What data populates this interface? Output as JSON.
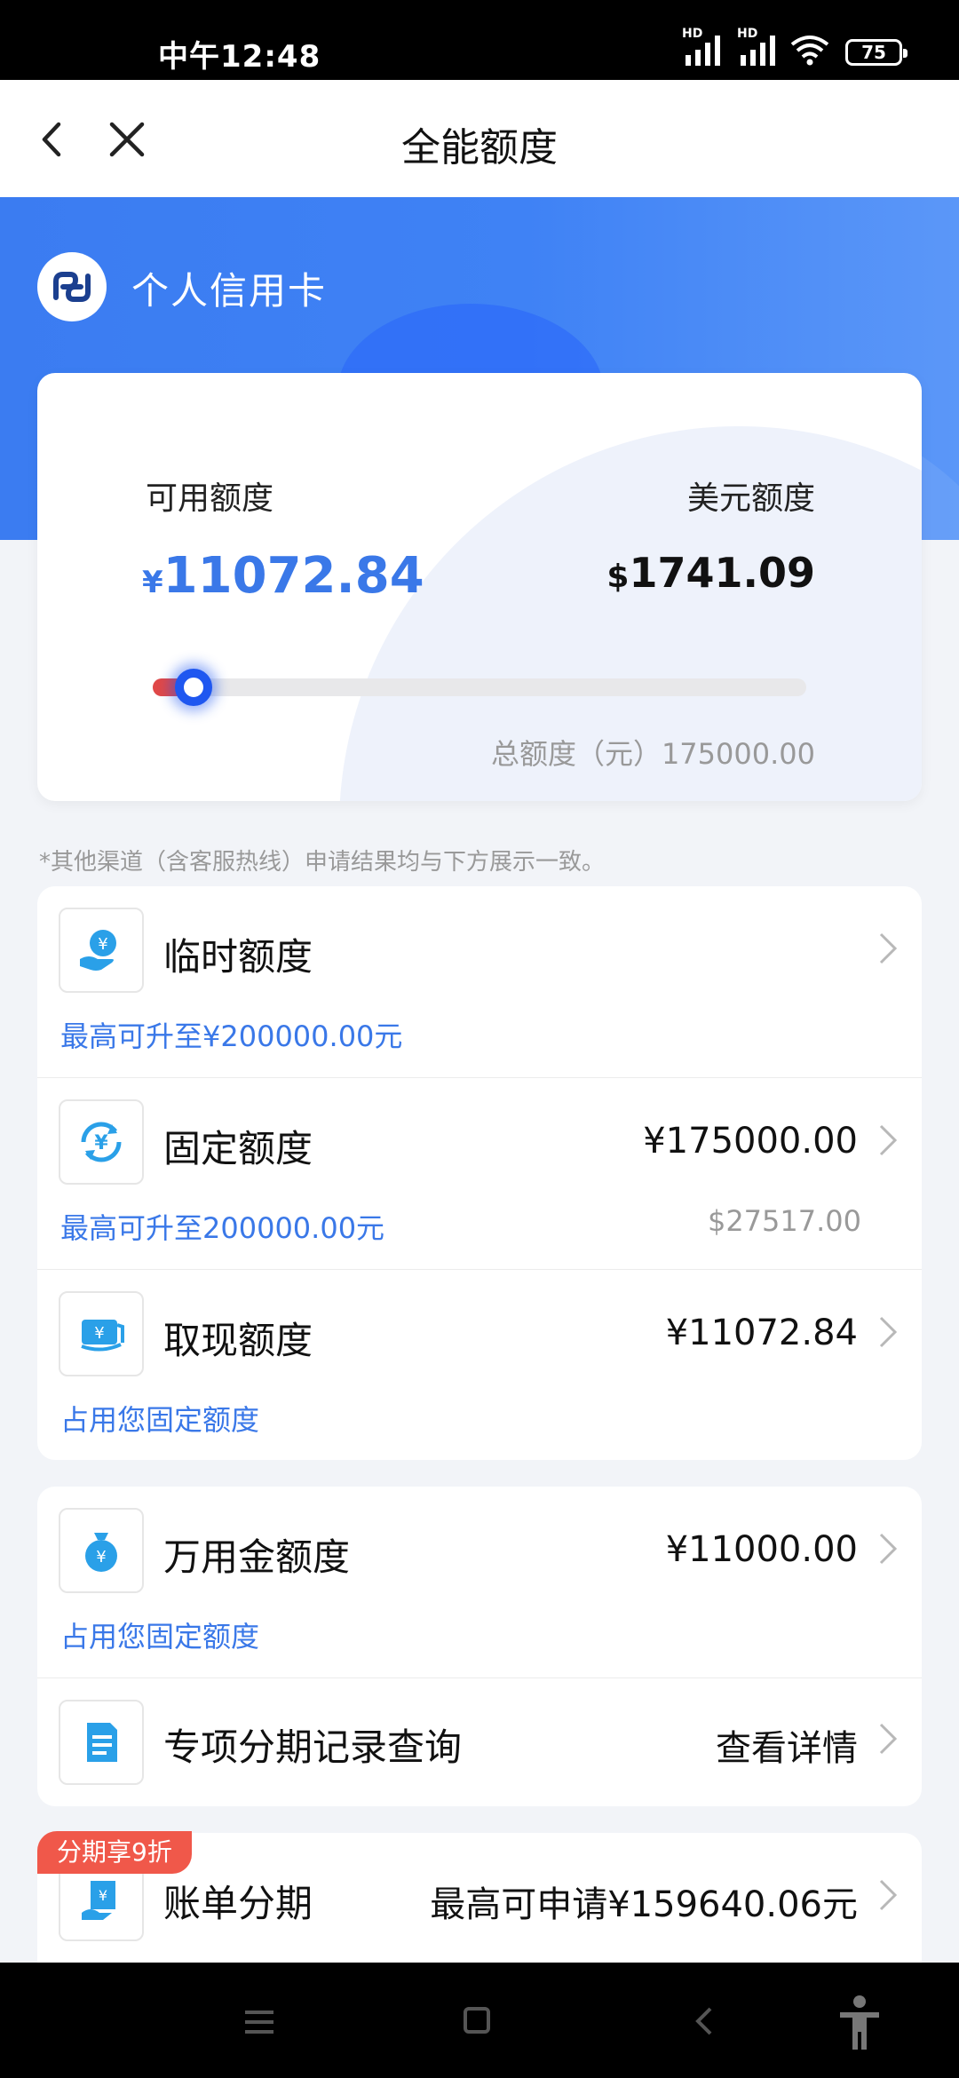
{
  "status_bar": {
    "time": "中午12:48",
    "hd1": "HD",
    "hd2": "HD",
    "battery": "75"
  },
  "nav": {
    "title": "全能额度"
  },
  "header": {
    "brand": "个人信用卡"
  },
  "limit_card": {
    "available_label": "可用额度",
    "usd_label": "美元额度",
    "available_currency": "¥",
    "available_value": "11072.84",
    "usd_currency": "$",
    "usd_value": "1741.09",
    "total_text": "总额度（元）175000.00",
    "usage_fraction": 0.063
  },
  "note": "*其他渠道（含客服热线）申请结果均与下方展示一致。",
  "card1": {
    "temp": {
      "name": "临时额度",
      "sub": "最高可升至¥200000.00元"
    },
    "fixed": {
      "name": "固定额度",
      "value": "¥175000.00",
      "sub": "最高可升至200000.00元",
      "sub_right": "$27517.00"
    },
    "cash": {
      "name": "取现额度",
      "value": "¥11072.84",
      "sub": "占用您固定额度"
    }
  },
  "card2": {
    "wanyong": {
      "name": "万用金额度",
      "value": "¥11000.00",
      "sub": "占用您固定额度"
    },
    "special": {
      "name": "专项分期记录查询",
      "value": "查看详情"
    }
  },
  "card3": {
    "badge": "分期享9折",
    "bill": {
      "name": "账单分期",
      "value": "最高可申请¥159640.06元"
    }
  },
  "colors": {
    "accent": "#3a78e8",
    "header_blue": "#3f82f5",
    "badge_red": "#f0584a",
    "knob_blue": "#1f57f0"
  }
}
